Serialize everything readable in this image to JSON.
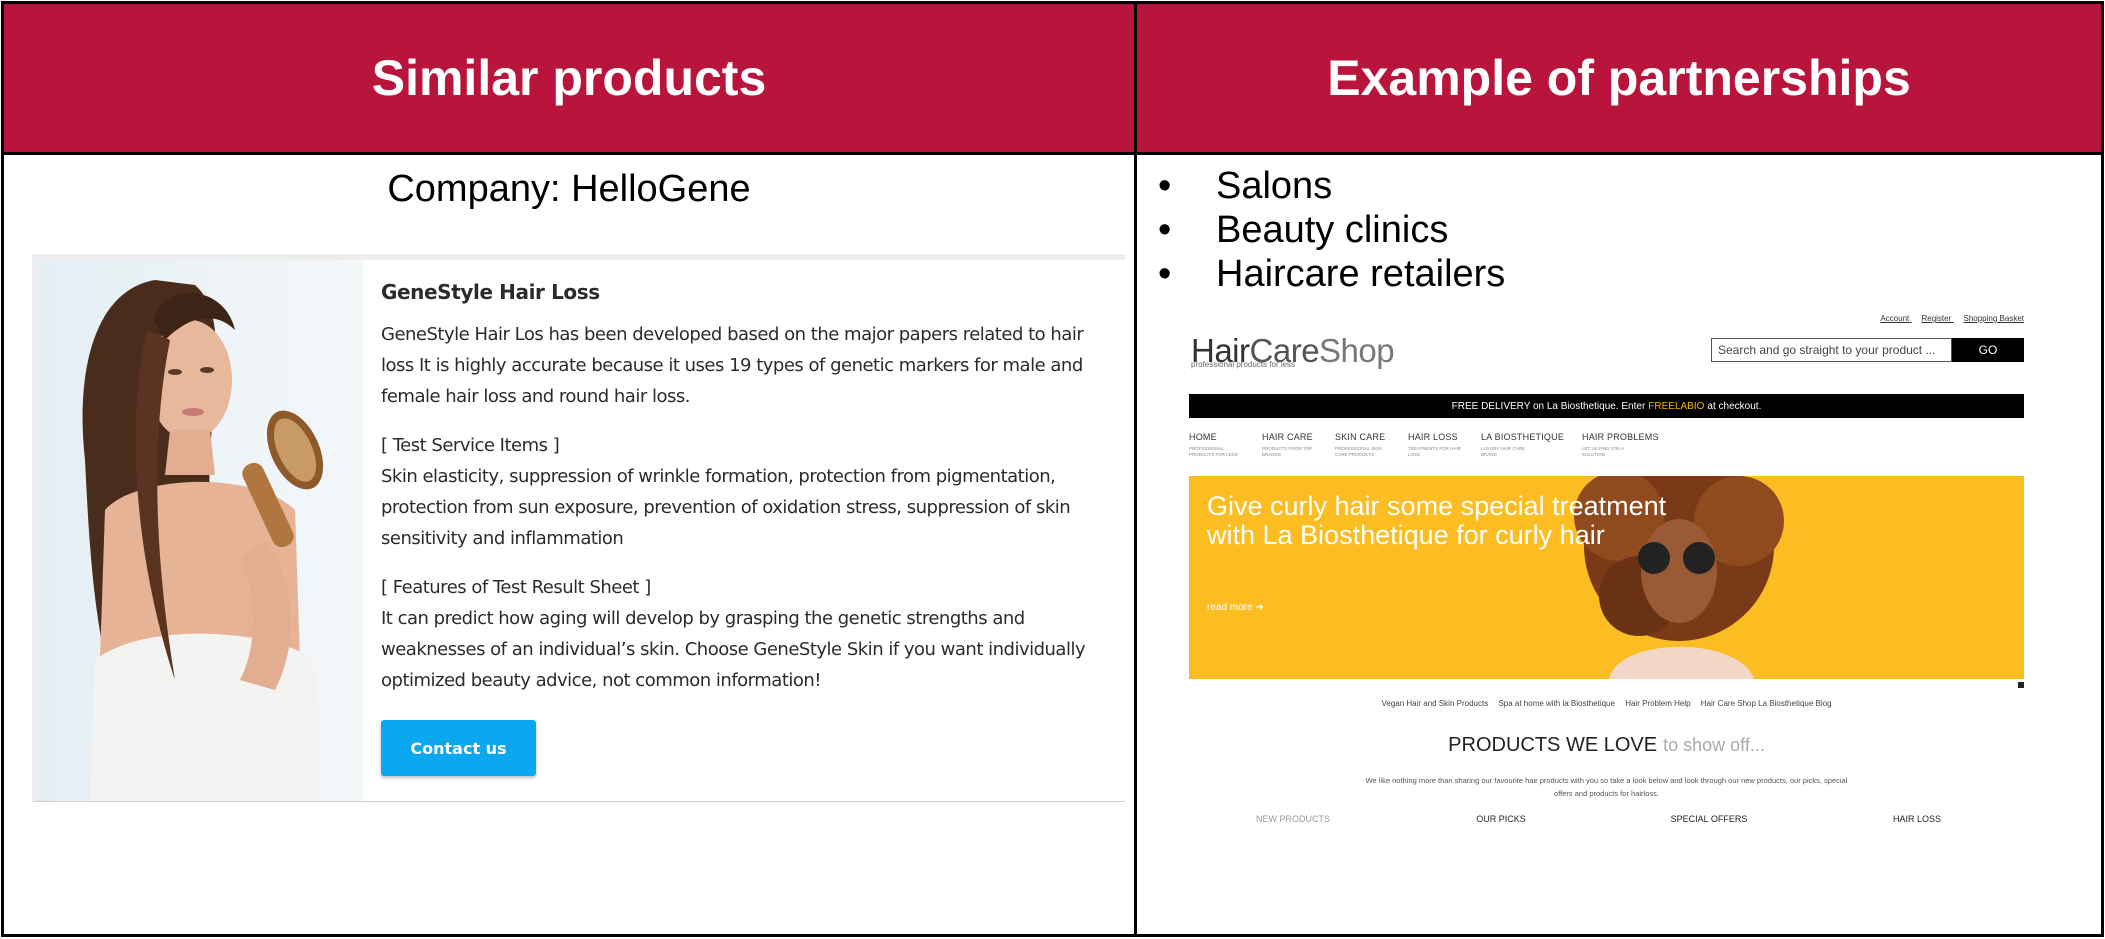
{
  "headers": {
    "left": "Similar products",
    "right": "Example of partnerships"
  },
  "company_line": "Company: HelloGene",
  "product": {
    "title": "GeneStyle Hair Loss",
    "description": "GeneStyle Hair Los has been developed based on the major papers related to hair loss It is highly accurate because it uses 19 types of genetic markers for male and female hair loss and round hair loss.",
    "test_items_heading": "[ Test Service Items ]",
    "test_items_text": "Skin elasticity, suppression of wrinkle formation, protection from pigmentation, protection from sun exposure, prevention of oxidation stress, suppression of skin sensitivity and inflammation",
    "features_heading": "[ Features of Test Result Sheet ]",
    "features_text": "It can predict how aging will develop by grasping the genetic strengths and weaknesses of an individual’s skin. Choose GeneStyle Skin if you want individually optimized beauty advice, not common information!",
    "contact_button": "Contact us"
  },
  "partners": [
    "Salons",
    "Beauty clinics",
    "Haircare retailers"
  ],
  "bullet_glyph": "•",
  "shop": {
    "top_links": [
      "Account",
      "Register",
      "Shopping Basket"
    ],
    "logo_a": "Hair",
    "logo_b": "Care",
    "logo_c": "Shop",
    "tagline": "professional products for less",
    "search_placeholder": "Search and go straight to your product ...",
    "go_label": "GO",
    "promo_before": "FREE DELIVERY on La Biosthetique. Enter",
    "promo_code": "FREELABIO",
    "promo_after": "at checkout.",
    "nav": [
      {
        "title": "HOME",
        "sub": "PROFESSIONAL PRODUCTS FOR LESS"
      },
      {
        "title": "HAIR CARE",
        "sub": "PRODUCTS FROM TOP BRANDS"
      },
      {
        "title": "SKIN CARE",
        "sub": "PROFESSIONAL SKIN CARE PRODUCTS"
      },
      {
        "title": "HAIR LOSS",
        "sub": "TREATMENTS FOR HAIR LOSS"
      },
      {
        "title": "LA BIOSTHETIQUE",
        "sub": "LUXURY HAIR CARE BRAND"
      },
      {
        "title": "HAIR PROBLEMS",
        "sub": "LET US FIND YOU A SOLUTION"
      }
    ],
    "hero_text": "Give curly hair some special treatment with La Biosthetique for curly hair",
    "read_more": "read more ➔",
    "image_links": [
      "Vegan Hair and Skin Products",
      "Spa at home with la Biosthetique",
      "Hair Problem Help",
      "Hair Care Shop La Biosthetique Blog"
    ],
    "section_title": "PRODUCTS WE LOVE",
    "section_sub": "to show off...",
    "section_desc": "We like nothing more than sharing our favourite hair products with you so take a look below and look through our new products, our picks, special offers and products for hairloss.",
    "tabs": [
      "NEW PRODUCTS",
      "OUR PICKS",
      "SPECIAL OFFERS",
      "HAIR LOSS"
    ]
  },
  "colors": {
    "header_bg": "#b8143c",
    "button_blue": "#0ba7ef",
    "hero_yellow": "#fbbd22",
    "promo_code": "#f4b400"
  }
}
